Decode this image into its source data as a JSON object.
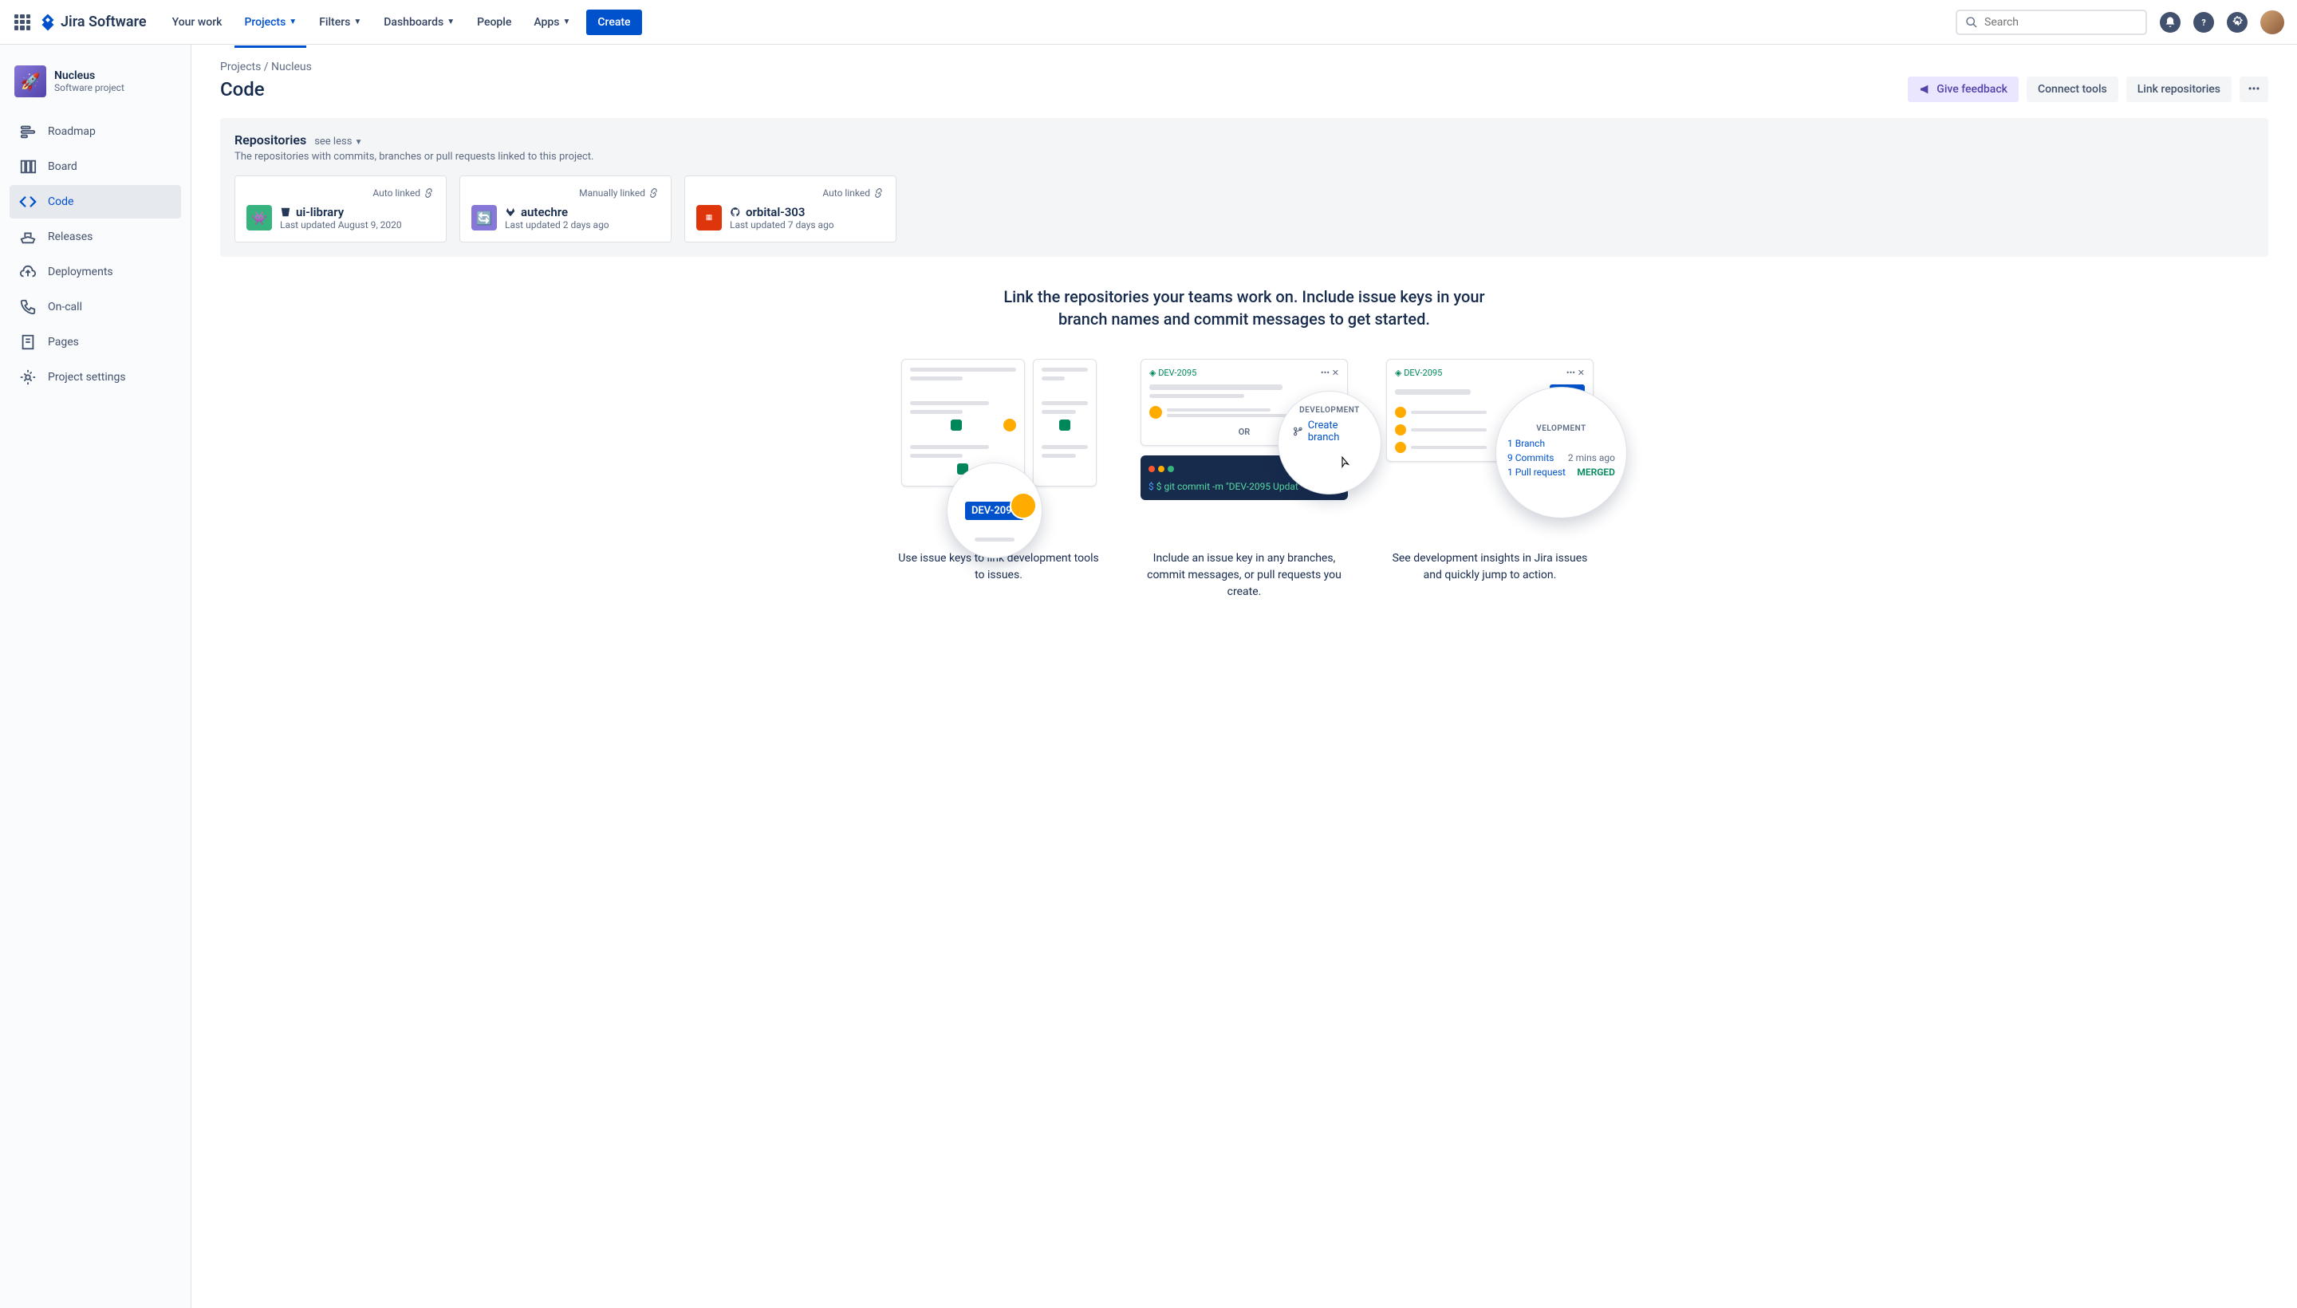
{
  "header": {
    "logo_text": "Jira Software",
    "nav": [
      "Your work",
      "Projects",
      "Filters",
      "Dashboards",
      "People",
      "Apps"
    ],
    "create": "Create",
    "search_placeholder": "Search"
  },
  "sidebar": {
    "project_name": "Nucleus",
    "project_sub": "Software project",
    "items": [
      {
        "label": "Roadmap"
      },
      {
        "label": "Board"
      },
      {
        "label": "Code"
      },
      {
        "label": "Releases"
      },
      {
        "label": "Deployments"
      },
      {
        "label": "On-call"
      },
      {
        "label": "Pages"
      },
      {
        "label": "Project settings"
      }
    ]
  },
  "breadcrumb": "Projects / Nucleus",
  "page_title": "Code",
  "actions": {
    "feedback": "Give feedback",
    "connect": "Connect tools",
    "link": "Link repositories"
  },
  "repos": {
    "title": "Repositories",
    "see_less": "see less",
    "desc": "The repositories with commits, branches or pull requests linked to this project.",
    "cards": [
      {
        "link_type": "Auto linked",
        "name": "ui-library",
        "updated": "Last updated August 9, 2020",
        "color": "#36B37E"
      },
      {
        "link_type": "Manually linked",
        "name": "autechre",
        "updated": "Last updated 2 days ago",
        "color": "#8777D9"
      },
      {
        "link_type": "Auto linked",
        "name": "orbital-303",
        "updated": "Last updated 7 days ago",
        "color": "#DE350B"
      }
    ]
  },
  "hero": "Link the repositories your teams work on. Include issue keys in your branch names and commit messages to get started.",
  "illus": {
    "captions": [
      "Use issue keys to link development tools to issues.",
      "Include an issue key in any branches, commit messages, or pull requests you create.",
      "See development insights in Jira issues and quickly jump to action."
    ],
    "issue_key": "DEV-2095",
    "dev_label": "DEVELOPMENT",
    "create_branch": "Create branch",
    "or": "OR",
    "terminal_cmd": "$ git commit -m \"DEV-2095 Updat",
    "dev_panel": {
      "branch": "1 Branch",
      "commits": "9 Commits",
      "commits_time": "2 mins ago",
      "pr": "1 Pull request",
      "merged": "MERGED"
    }
  }
}
